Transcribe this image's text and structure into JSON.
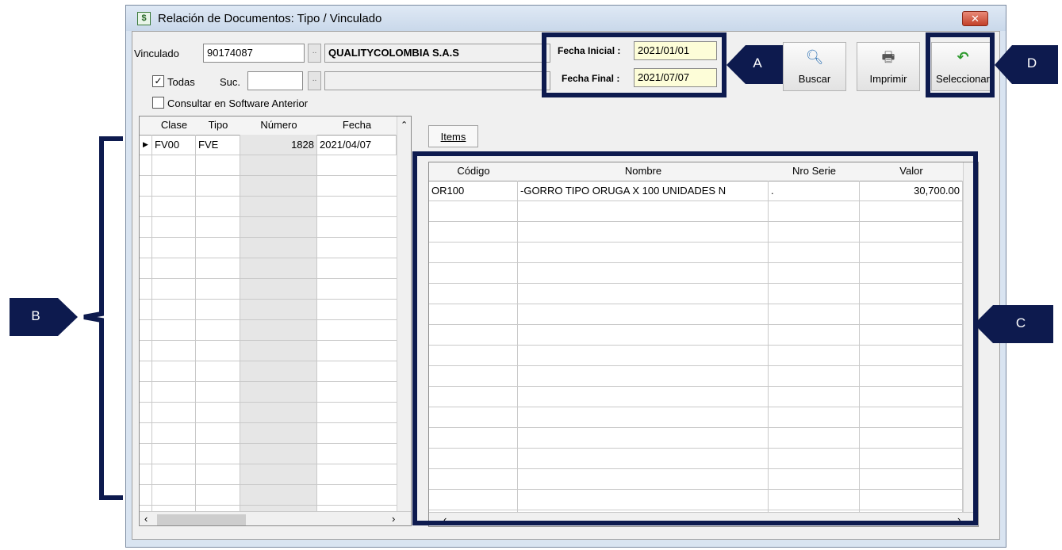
{
  "window": {
    "title": "Relación de Documentos: Tipo / Vinculado",
    "icon": "document-dollar-icon",
    "close_label": "✕"
  },
  "filters": {
    "vinculado_label": "Vinculado",
    "vinculado_value": "90174087",
    "vinculado_lookup": "..",
    "vinculado_name": "QUALITYCOLOMBIA S.A.S",
    "todas_label": "Todas",
    "todas_checked": true,
    "suc_label": "Suc.",
    "suc_value": "",
    "suc_lookup": "..",
    "suc_name": "",
    "consultar_label": "Consultar en Software Anterior",
    "consultar_checked": false
  },
  "dates": {
    "inicial_label": "Fecha Inicial :",
    "inicial_value": "2021/01/01",
    "final_label": "Fecha Final :",
    "final_value": "2021/07/07"
  },
  "toolbar": {
    "buscar": {
      "label": "Buscar",
      "icon": "magnifier-icon"
    },
    "imprimir": {
      "label": "Imprimir",
      "icon": "printer-icon"
    },
    "seleccionar": {
      "label": "Seleccionar",
      "icon": "green-return-arrow-icon"
    }
  },
  "documents": {
    "columns": [
      "Clase",
      "Tipo",
      "Número",
      "Fecha"
    ],
    "rows": [
      {
        "clase": "FV00",
        "tipo": "FVE",
        "numero": "1828",
        "fecha": "2021/04/07"
      }
    ]
  },
  "items": {
    "tab_label": "Items",
    "columns": [
      "Código",
      "Nombre",
      "Nro Serie",
      "Valor"
    ],
    "rows": [
      {
        "codigo": "OR100",
        "nombre": "-GORRO TIPO ORUGA X 100 UNIDADES N",
        "serie": ".",
        "valor": "30,700.00"
      }
    ]
  },
  "callouts": {
    "a": "A",
    "b": "B",
    "c": "C",
    "d": "D",
    "color": "#0d1a4e"
  }
}
